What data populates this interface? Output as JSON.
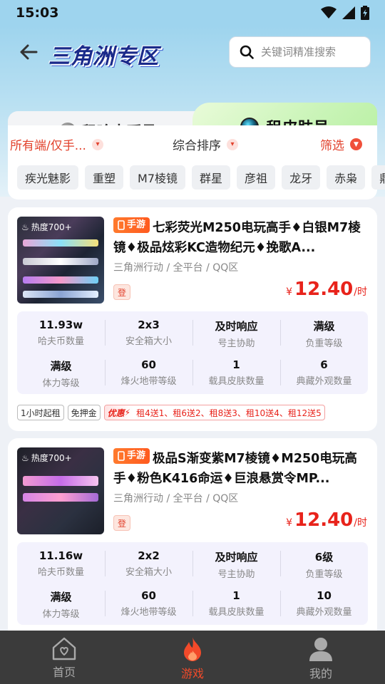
{
  "status_bar": {
    "time": "15:03"
  },
  "header": {
    "title": "三角洲专区",
    "search_placeholder": "关键词精准搜索"
  },
  "tabs": [
    {
      "label": "租哈夫币号",
      "active": false
    },
    {
      "label": "租皮肤号",
      "active": true
    }
  ],
  "filters": {
    "platform": "所有端/仅手...",
    "sort": "综合排序",
    "screen": "筛选"
  },
  "chips": [
    "疾光魅影",
    "重塑",
    "M7棱镜",
    "群星",
    "彦祖",
    "龙牙",
    "赤枭",
    "鼎"
  ],
  "listings": [
    {
      "heat": "热度700+",
      "platform_tag": "手游",
      "title": "七彩荧光M250电玩高手♦白银M7棱镜♦极品炫彩KC造物纪元♦挽歌A...",
      "meta": "三角洲行动 / 全平台 / QQ区",
      "login_tag": "登",
      "price_currency": "¥",
      "price": "12.40",
      "price_unit": "/时",
      "specs": [
        {
          "value": "11.93w",
          "label": "哈夫币数量"
        },
        {
          "value": "2x3",
          "label": "安全箱大小"
        },
        {
          "value": "及时响应",
          "label": "号主协助"
        },
        {
          "value": "满级",
          "label": "负重等级"
        },
        {
          "value": "满级",
          "label": "体力等级"
        },
        {
          "value": "60",
          "label": "烽火地带等级"
        },
        {
          "value": "1",
          "label": "载具皮肤数量"
        },
        {
          "value": "6",
          "label": "典藏外观数量"
        }
      ],
      "tags": [
        "1小时起租",
        "免押金"
      ],
      "promo_badge": "优惠",
      "promo_text": "租4送1、租6送2、租8送3、租10送4、租12送5"
    },
    {
      "heat": "热度700+",
      "platform_tag": "手游",
      "title": "极品S渐变紫M7棱镜♦M250电玩高手♦粉色K416命运♦巨浪悬赏令MP...",
      "meta": "三角洲行动 / 全平台 / QQ区",
      "login_tag": "登",
      "price_currency": "¥",
      "price": "12.40",
      "price_unit": "/时",
      "specs": [
        {
          "value": "11.16w",
          "label": "哈夫币数量"
        },
        {
          "value": "2x2",
          "label": "安全箱大小"
        },
        {
          "value": "及时响应",
          "label": "号主协助"
        },
        {
          "value": "6级",
          "label": "负重等级"
        },
        {
          "value": "满级",
          "label": "体力等级"
        },
        {
          "value": "60",
          "label": "烽火地带等级"
        },
        {
          "value": "1",
          "label": "载具皮肤数量"
        },
        {
          "value": "10",
          "label": "典藏外观数量"
        }
      ]
    }
  ],
  "bottom_nav": [
    {
      "label": "首页",
      "icon": "home-icon",
      "active": false
    },
    {
      "label": "游戏",
      "icon": "flame-icon",
      "active": true
    },
    {
      "label": "我的",
      "icon": "user-icon",
      "active": false
    }
  ],
  "colors": {
    "accent": "#e8231b",
    "filter_active": "#e2422d",
    "nav_active": "#f24a2a",
    "header_bg": "#9ed4ee",
    "active_tab_bg": "#c9f4b7"
  }
}
